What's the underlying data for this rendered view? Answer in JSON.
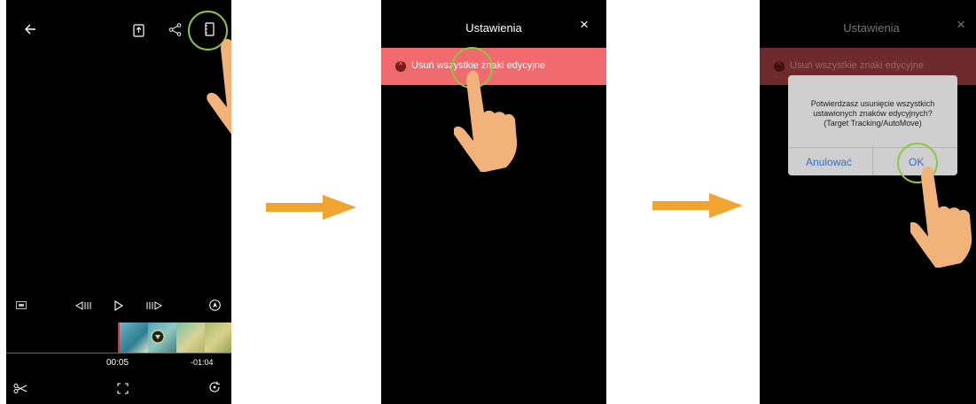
{
  "screen1": {
    "playback": {
      "current_time": "00:05",
      "remaining_time": "-01:04"
    }
  },
  "screen2": {
    "title": "Ustawienia",
    "close_label": "×",
    "banner_text": "Usuń wszystkie znaki edycyjne"
  },
  "screen3": {
    "title": "Ustawienia",
    "close_label": "×",
    "banner_text": "Usuń wszystkie znaki edycyjne",
    "dialog": {
      "message_line1": "Potwierdzasz usunięcie wszystkich",
      "message_line2": "ustawionych znaków edycyjnych?",
      "message_line3": "(Target Tracking/AutoMove)",
      "cancel_label": "Anulować",
      "ok_label": "OK"
    }
  },
  "colors": {
    "highlight_ring": "#8dc63f",
    "arrow": "#f2a431",
    "banner": "#f06a6e",
    "hand": "#f2b37a"
  }
}
